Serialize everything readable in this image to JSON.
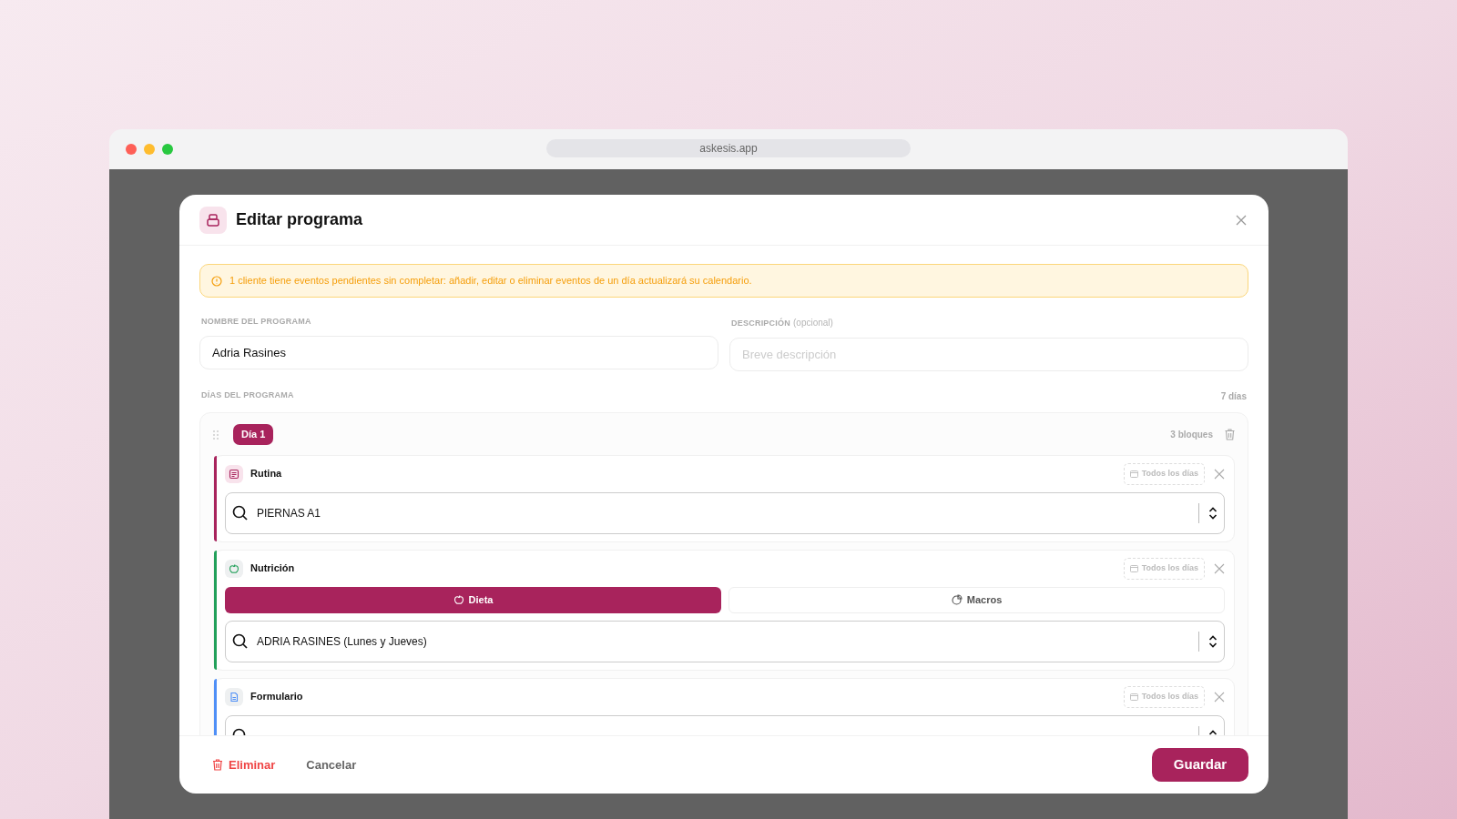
{
  "browser": {
    "url": "askesis.app"
  },
  "dialog": {
    "title": "Editar programa",
    "alert": "1 cliente tiene eventos pendientes sin completar: añadir, editar o eliminar eventos de un día actualizará su calendario.",
    "fields": [
      {
        "label": "NOMBRE DEL PROGRAMA",
        "value": "Adria Rasines"
      },
      {
        "label": "DESCRIPCIÓN",
        "note": "(opcional)",
        "placeholder": "Breve descripción"
      }
    ],
    "days_label": "DÍAS DEL PROGRAMA",
    "days_count": "7 días",
    "days": [
      {
        "label": "Día 1",
        "blocks_count": "3 bloques",
        "blocks": [
          {
            "kind": "routine",
            "title": "Rutina",
            "color": "#a8235c",
            "schedule": "Todos los días",
            "value": "PIERNAS A1"
          },
          {
            "kind": "nutrition",
            "title": "Nutrición",
            "color": "#22a05a",
            "schedule": "Todos los días",
            "options": [
              {
                "label": "Dieta",
                "selected": true
              },
              {
                "label": "Macros",
                "selected": false
              }
            ],
            "value": "ADRIA RASINES (Lunes y Jueves)"
          },
          {
            "kind": "form",
            "title": "Formulario",
            "color": "#4f8ff7",
            "schedule": "Todos los días"
          }
        ]
      }
    ],
    "footer": {
      "delete": "Eliminar",
      "cancel": "Cancelar",
      "save": "Guardar"
    }
  }
}
